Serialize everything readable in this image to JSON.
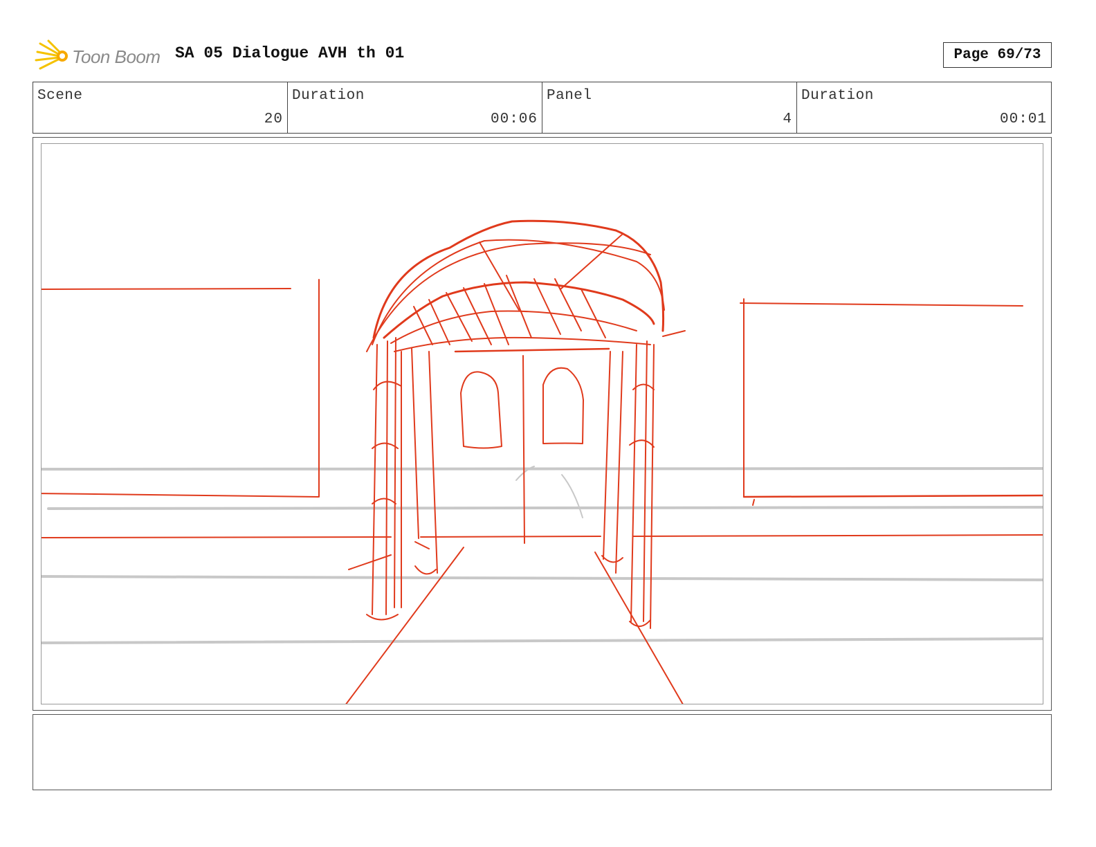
{
  "header": {
    "logo_text": "Toon Boom",
    "title": "SA 05 Dialogue AVH th 01",
    "page_label": "Page 69/73"
  },
  "info": [
    {
      "label": "Scene",
      "value": "20"
    },
    {
      "label": "Duration",
      "value": "00:06"
    },
    {
      "label": "Panel",
      "value": "4"
    },
    {
      "label": "Duration",
      "value": "00:01"
    }
  ],
  "colors": {
    "sketch_red": "#e03a1c",
    "guide_gray": "#c8c8c8",
    "logo_yellow": "#f5c200"
  },
  "icons": {
    "logo": "toon-boom-starburst-icon"
  },
  "notes": ""
}
